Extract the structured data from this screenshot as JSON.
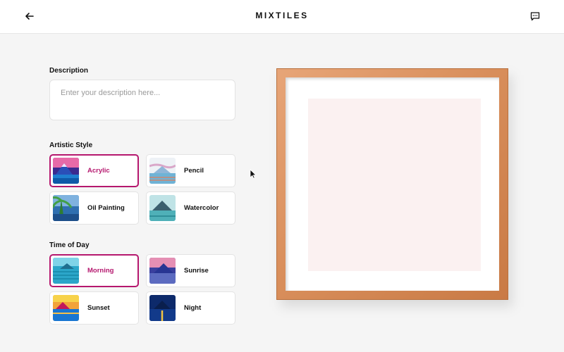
{
  "header": {
    "brand": "MIXTILES",
    "back_icon": "arrow-left-icon",
    "chat_icon": "chat-icon"
  },
  "description": {
    "label": "Description",
    "value": "",
    "placeholder": "Enter your description here..."
  },
  "artistic_style": {
    "label": "Artistic Style",
    "selected": "Acrylic",
    "options": [
      {
        "label": "Acrylic",
        "selected": true
      },
      {
        "label": "Pencil",
        "selected": false
      },
      {
        "label": "Oil Painting",
        "selected": false
      },
      {
        "label": "Watercolor",
        "selected": false
      }
    ]
  },
  "time_of_day": {
    "label": "Time of Day",
    "selected": "Morning",
    "options": [
      {
        "label": "Morning",
        "selected": true
      },
      {
        "label": "Sunrise",
        "selected": false
      },
      {
        "label": "Sunset",
        "selected": false
      },
      {
        "label": "Night",
        "selected": false
      }
    ]
  },
  "colors": {
    "accent": "#b5176e",
    "frame_wood": "#d98f5c",
    "canvas_placeholder": "#fbf1f1"
  }
}
